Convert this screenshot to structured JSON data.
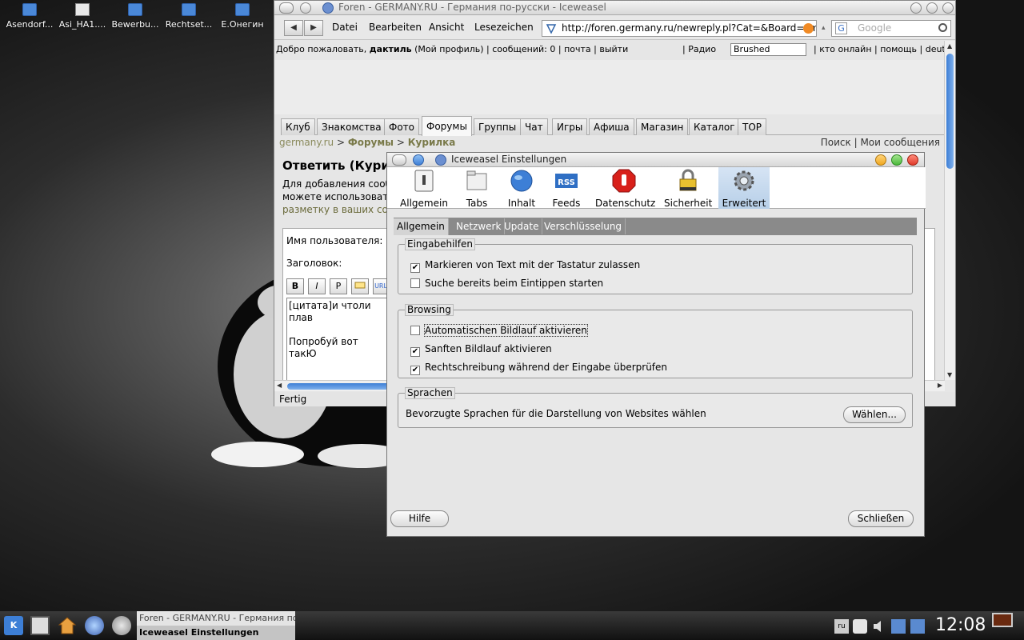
{
  "desktop": {
    "icons": [
      {
        "label": "Asendorf...",
        "kind": "folder"
      },
      {
        "label": "Asi_HA1....",
        "kind": "doc"
      },
      {
        "label": "Bewerbu...",
        "kind": "folder"
      },
      {
        "label": "Rechtset...",
        "kind": "folder"
      },
      {
        "label": "E.Онегин",
        "kind": "folder"
      }
    ]
  },
  "browser": {
    "title": "Foren - GERMANY.RU - Германия по-русски - Iceweasel",
    "menu": {
      "datei": "Datei",
      "bearbeiten": "Bearbeiten",
      "ansicht": "Ansicht",
      "lesezeichen": "Lesezeichen"
    },
    "url": "http://foren.germany.ru/newreply.pl?Cat=&Board=smok",
    "search_placeholder": "Google",
    "search_engine_letter": "G",
    "userbar": {
      "welcome": "Добро пожаловать, ",
      "user": "дактиль",
      "rest": "(Мой профиль) | сообщений: 0 | почта | выйти",
      "radio": "| Радио",
      "radio_value": "Brushed",
      "tail": "| кто онлайн | помощь | deutsch"
    },
    "tabs": [
      {
        "label": "Клуб",
        "active": false
      },
      {
        "label": "Знакомства",
        "active": false
      },
      {
        "label": "Фото",
        "active": false
      },
      {
        "label": "Форумы",
        "active": true
      },
      {
        "label": "Группы",
        "active": false
      },
      {
        "label": "Чат",
        "active": false
      },
      {
        "label": "Игры",
        "active": false
      },
      {
        "label": "Афиша",
        "active": false
      },
      {
        "label": "Магазин",
        "active": false
      },
      {
        "label": "Каталог",
        "active": false
      },
      {
        "label": "TOP",
        "active": false
      }
    ],
    "breadcrumb": {
      "site": "germany.ru",
      "sep": " > ",
      "forums": "Форумы",
      "board": "Курилка",
      "right": "Поиск | Мои сообщения"
    },
    "reply_heading": "Ответить (Курилка)",
    "reply_desc": [
      "Для добавления сообщения",
      "можете использовать",
      "разметку в ваших сообщениях"
    ],
    "form": {
      "username_label": "Имя пользователя:",
      "subject_label": "Заголовок:",
      "fmt_buttons": [
        "B",
        "I",
        "P",
        "",
        "URL"
      ],
      "text_line1": "[цитата]и чтоли плав",
      "text_line2": "Попробуй вот такЮ"
    },
    "status": "Fertig"
  },
  "dialog": {
    "title": "Iceweasel Einstellungen",
    "toolbar": [
      {
        "label": "Allgemein",
        "icon": "switch-icon"
      },
      {
        "label": "Tabs",
        "icon": "tabs-icon"
      },
      {
        "label": "Inhalt",
        "icon": "globe-icon"
      },
      {
        "label": "Feeds",
        "icon": "rss-icon"
      },
      {
        "label": "Datenschutz",
        "icon": "hand-stop-icon"
      },
      {
        "label": "Sicherheit",
        "icon": "padlock-icon"
      },
      {
        "label": "Erweitert",
        "icon": "gear-icon"
      }
    ],
    "subtabs": [
      "Allgemein",
      "Netzwerk",
      "Update",
      "Verschlüsselung"
    ],
    "groups": {
      "eingabehilfen": {
        "title": "Eingabehilfen",
        "items": [
          {
            "label": "Markieren von Text mit der Tastatur zulassen",
            "checked": true
          },
          {
            "label": "Suche bereits beim Eintippen starten",
            "checked": false
          }
        ]
      },
      "browsing": {
        "title": "Browsing",
        "items": [
          {
            "label": "Automatischen Bildlauf aktivieren",
            "checked": false
          },
          {
            "label": "Sanften Bildlauf aktivieren",
            "checked": true
          },
          {
            "label": "Rechtschreibung während der Eingabe überprüfen",
            "checked": true
          }
        ]
      },
      "sprachen": {
        "title": "Sprachen",
        "text": "Bevorzugte Sprachen für die Darstellung von Websites wählen",
        "button": "Wählen..."
      }
    },
    "help_button": "Hilfe",
    "close_button": "Schließen"
  },
  "taskbar": {
    "tasks": [
      "Foren - GERMANY.RU - Германия по-русски",
      "Iceweasel Einstellungen"
    ],
    "keyboard_layout": "ru",
    "clock": "12:08"
  },
  "colors": {
    "accent": "#3d7fd6",
    "close": "#e03a2a",
    "minimize": "#f0a820",
    "maximize": "#4ab83a"
  }
}
